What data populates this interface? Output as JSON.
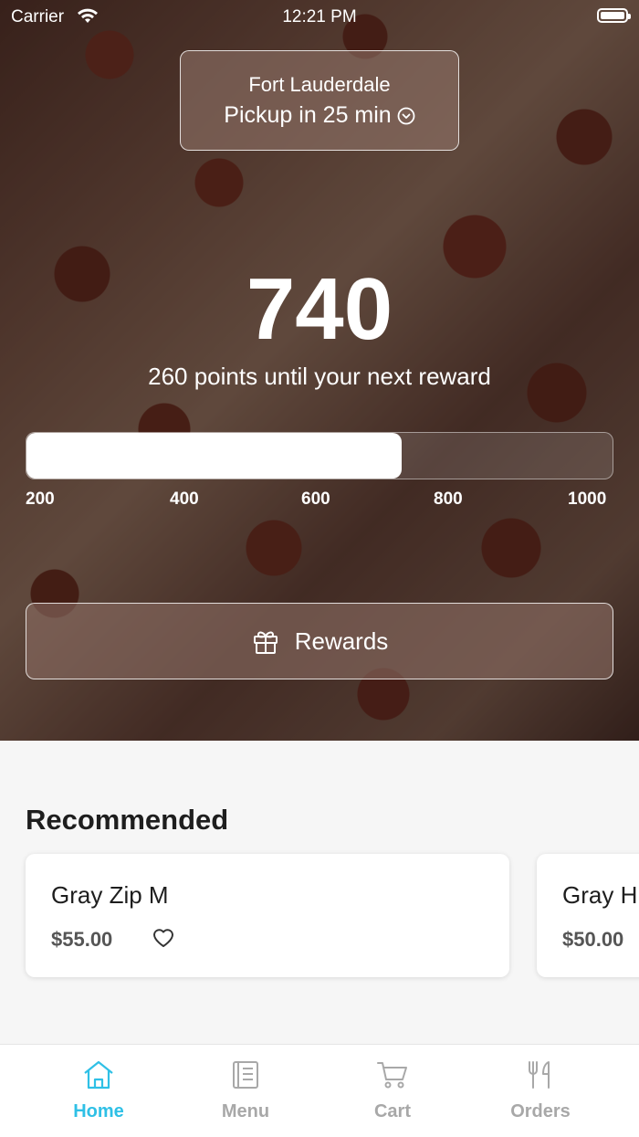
{
  "status_bar": {
    "carrier": "Carrier",
    "time": "12:21 PM"
  },
  "location": {
    "city": "Fort Lauderdale",
    "pickup": "Pickup in 25 min"
  },
  "loyalty": {
    "points": "740",
    "subtitle": "260 points until your next reward",
    "progress_fraction": 0.64,
    "ticks": [
      "200",
      "400",
      "600",
      "800",
      "1000"
    ]
  },
  "rewards_button": {
    "label": "Rewards"
  },
  "recommended": {
    "title": "Recommended",
    "items": [
      {
        "name": "Gray Zip M",
        "price": "$55.00"
      },
      {
        "name": "Gray H",
        "price": "$50.00"
      }
    ]
  },
  "tabs": [
    {
      "label": "Home",
      "active": true
    },
    {
      "label": "Menu",
      "active": false
    },
    {
      "label": "Cart",
      "active": false
    },
    {
      "label": "Orders",
      "active": false
    }
  ],
  "colors": {
    "accent": "#2fc0e6",
    "inactive": "#a8a8a8"
  },
  "icons": [
    "wifi-icon",
    "battery-icon",
    "chevron-down-circle-icon",
    "gift-icon",
    "heart-icon",
    "home-icon",
    "menu-icon",
    "cart-icon",
    "orders-icon"
  ]
}
